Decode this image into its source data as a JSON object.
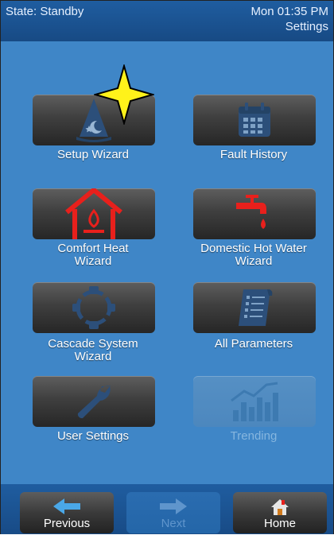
{
  "header": {
    "state": "State: Standby",
    "time": "Mon 01:35 PM",
    "page": "Settings"
  },
  "tiles": [
    {
      "label": "Setup Wizard",
      "icon": "wizard-hat-icon"
    },
    {
      "label": "Fault History",
      "icon": "calendar-icon"
    },
    {
      "label": "Comfort Heat Wizard",
      "icon": "house-flame-icon"
    },
    {
      "label": "Domestic Hot Water Wizard",
      "icon": "faucet-icon"
    },
    {
      "label": "Cascade System Wizard",
      "icon": "cascade-ring-icon"
    },
    {
      "label": "All Parameters",
      "icon": "document-list-icon"
    },
    {
      "label": "User Settings",
      "icon": "wrench-icon"
    },
    {
      "label": "Trending",
      "icon": "trend-chart-icon"
    }
  ],
  "tile_label_lines": {
    "comfort_heat": [
      "Comfort Heat",
      "Wizard"
    ],
    "dhw": [
      "Domestic Hot Water",
      "Wizard"
    ],
    "cascade": [
      "Cascade System",
      "Wizard"
    ]
  },
  "footer": {
    "previous": "Previous",
    "next": "Next",
    "home": "Home"
  },
  "colors": {
    "background": "#3f86c7",
    "header": "#1f5da0",
    "tile_dark": "#3f3f3f",
    "accent_red": "#e8201c",
    "cursor_star": "#fff21a"
  }
}
